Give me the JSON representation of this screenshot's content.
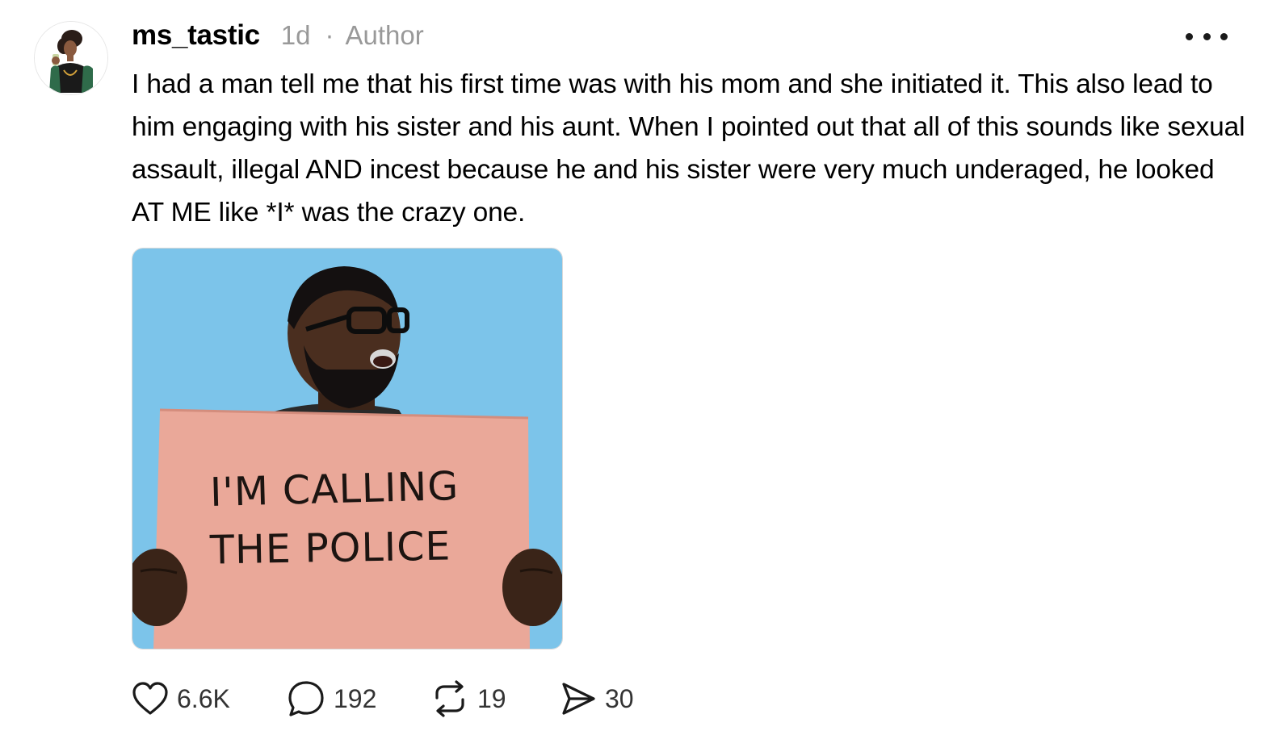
{
  "post": {
    "username": "ms_tastic",
    "time": "1d",
    "separator": "·",
    "author_badge": "Author",
    "text": "I had a man tell me that his first time was with his mom and she initiated it. This also lead to him engaging with his sister and his aunt. When I pointed out that all of this sounds like sexual assault, illegal AND incest because he and his sister were very much underaged, he looked AT ME like *I* was the crazy one.",
    "media": {
      "sign_line_1": "I'M CALLING",
      "sign_line_2": "THE POLICE"
    },
    "actions": {
      "likes": "6.6K",
      "replies": "192",
      "reposts": "19",
      "shares": "30"
    }
  },
  "icons": {
    "more": "more-options-icon",
    "like": "heart-icon",
    "reply": "comment-bubble-icon",
    "repost": "repost-arrows-icon",
    "share": "send-paper-plane-icon"
  },
  "colors": {
    "text": "#000000",
    "muted": "#999999",
    "media_background": "#7cc4ea",
    "sign": "#eaa899"
  }
}
